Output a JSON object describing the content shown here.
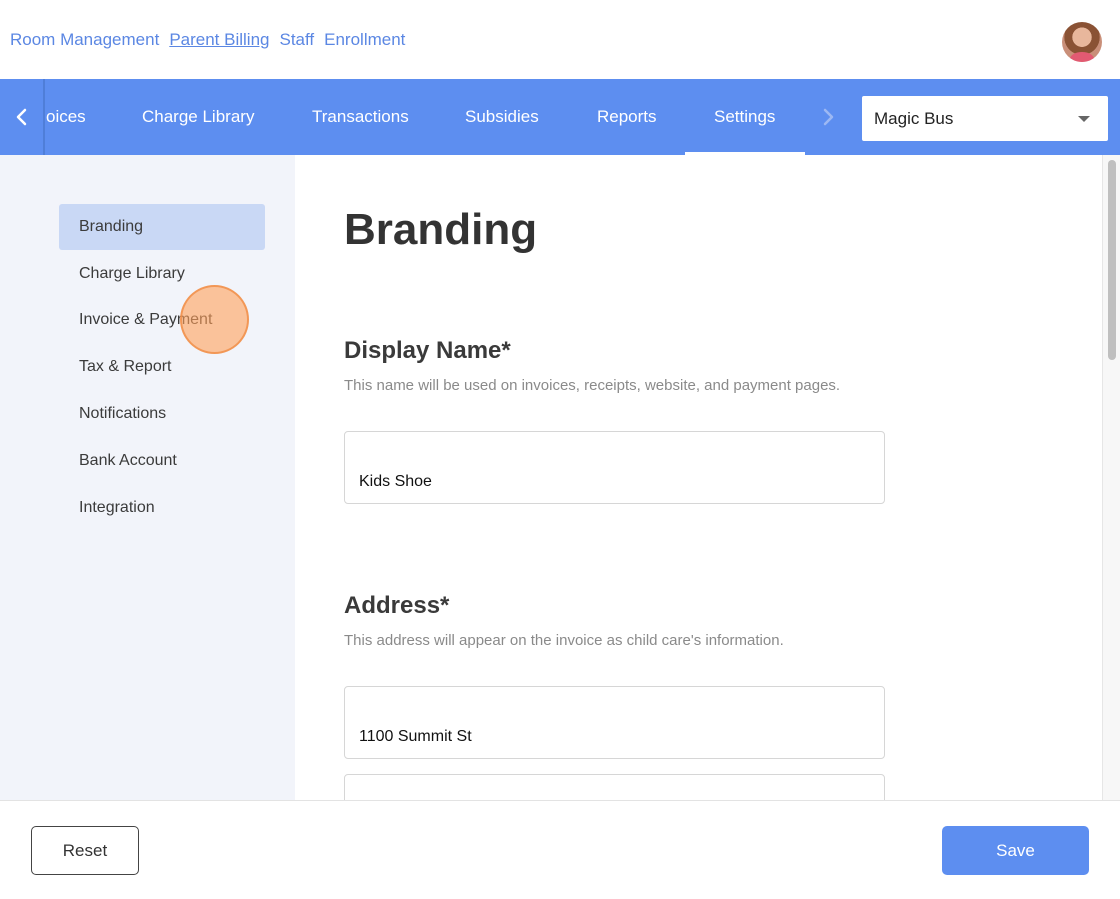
{
  "top_nav": {
    "links": [
      "Room Management",
      "Parent Billing",
      "Staff",
      "Enrollment"
    ],
    "active": "Parent Billing"
  },
  "tabs": {
    "items": [
      "oices",
      "Charge Library",
      "Transactions",
      "Subsidies",
      "Reports",
      "Settings"
    ],
    "active": "Settings",
    "prev_icon": "chevron-left-icon",
    "next_icon": "chevron-right-icon"
  },
  "org_select": {
    "value": "Magic Bus"
  },
  "sidebar": {
    "items": [
      "Branding",
      "Charge Library",
      "Invoice & Payment",
      "Tax & Report",
      "Notifications",
      "Bank Account",
      "Integration"
    ],
    "active": "Branding"
  },
  "main": {
    "title": "Branding",
    "display_name": {
      "label": "Display Name*",
      "description": "This name will be used on invoices, receipts, website, and payment pages.",
      "value": "Kids Shoe"
    },
    "address": {
      "label": "Address*",
      "description": "This address will appear on the invoice as child care's information.",
      "line1": "1100 Summit St",
      "line2": ""
    }
  },
  "footer": {
    "reset_label": "Reset",
    "save_label": "Save"
  },
  "colors": {
    "accent": "#5d8ef0",
    "sidebar_bg": "#f2f4fa",
    "sidebar_active": "#c9d8f5",
    "link": "#5b87e3"
  }
}
